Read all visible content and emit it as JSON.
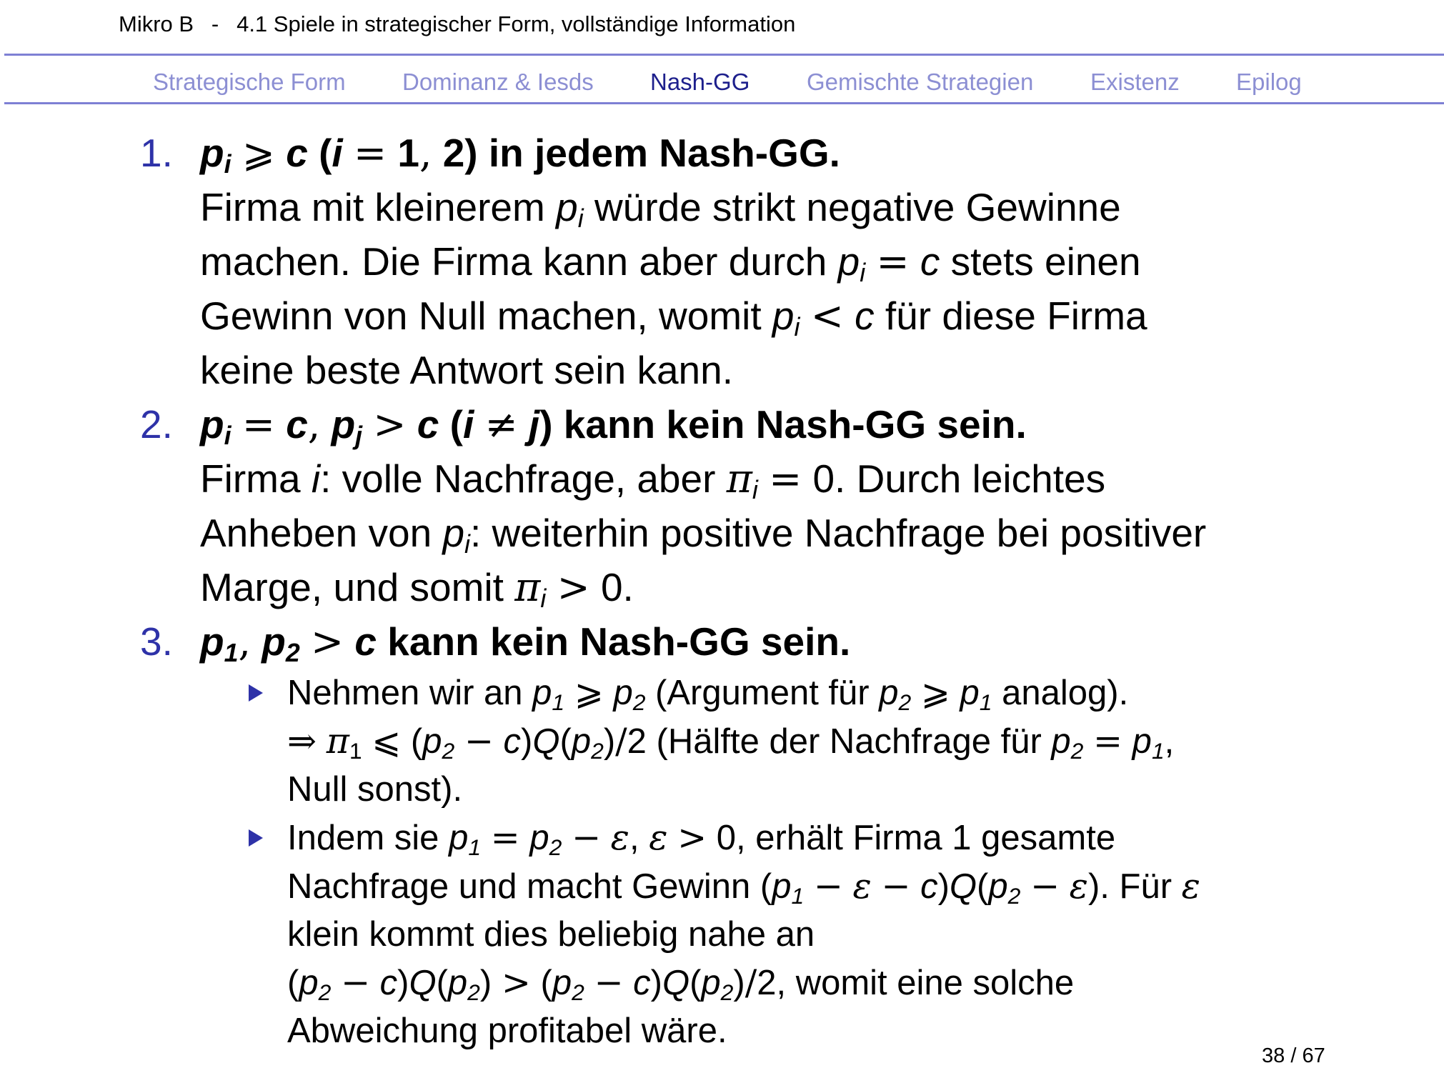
{
  "header": {
    "course": "Mikro B",
    "separator": "-",
    "section": "4.1 Spiele in strategischer Form, vollständige Information"
  },
  "nav": {
    "items": [
      "Strategische Form",
      "Dominanz & Iesds",
      "Nash-GG",
      "Gemischte Strategien",
      "Existenz",
      "Epilog"
    ],
    "active": "Nash-GG"
  },
  "items": [
    {
      "number": "1.",
      "heading": "p_i ⩾ c (i = 1,2) in jedem Nash-GG.",
      "body": "Firma mit kleinerem p_i würde strikt negative Gewinne machen. Die Firma kann aber durch p_i = c stets einen Gewinn von Null machen, womit p_i < c für diese Firma keine beste Antwort sein kann."
    },
    {
      "number": "2.",
      "heading": "p_i = c, p_j > c (i ≠ j) kann kein Nash-GG sein.",
      "body": "Firma i: volle Nachfrage, aber π_i = 0. Durch leichtes Anheben von p_i: weiterhin positive Nachfrage bei positiver Marge, und somit π_i > 0."
    },
    {
      "number": "3.",
      "heading": "p_1, p_2 > c kann kein Nash-GG sein.",
      "bullets": [
        "Nehmen wir an p_1 ⩾ p_2 (Argument für p_2 ⩾ p_1 analog). ⇒ π_1 ⩽ (p_2 − c)Q(p_2)/2 (Hälfte der Nachfrage für p_2 = p_1, Null sonst).",
        "Indem sie p_1 = p_2 − ε, ε > 0, erhält Firma 1 gesamte Nachfrage und macht Gewinn (p_1 − ε − c)Q(p_2 − ε). Für ε klein kommt dies beliebig nahe an (p_2 − c)Q(p_2) > (p_2 − c)Q(p_2)/2, womit eine solche Abweichung profitabel wäre."
      ]
    }
  ],
  "footer": {
    "current_page": "38",
    "total_pages": "67",
    "page_separator": "/"
  },
  "colors": {
    "accent": "#2e32a8",
    "nav_inactive": "#8c8fd3",
    "nav_active": "#1d1f8c",
    "rule": "#7e80d4"
  }
}
